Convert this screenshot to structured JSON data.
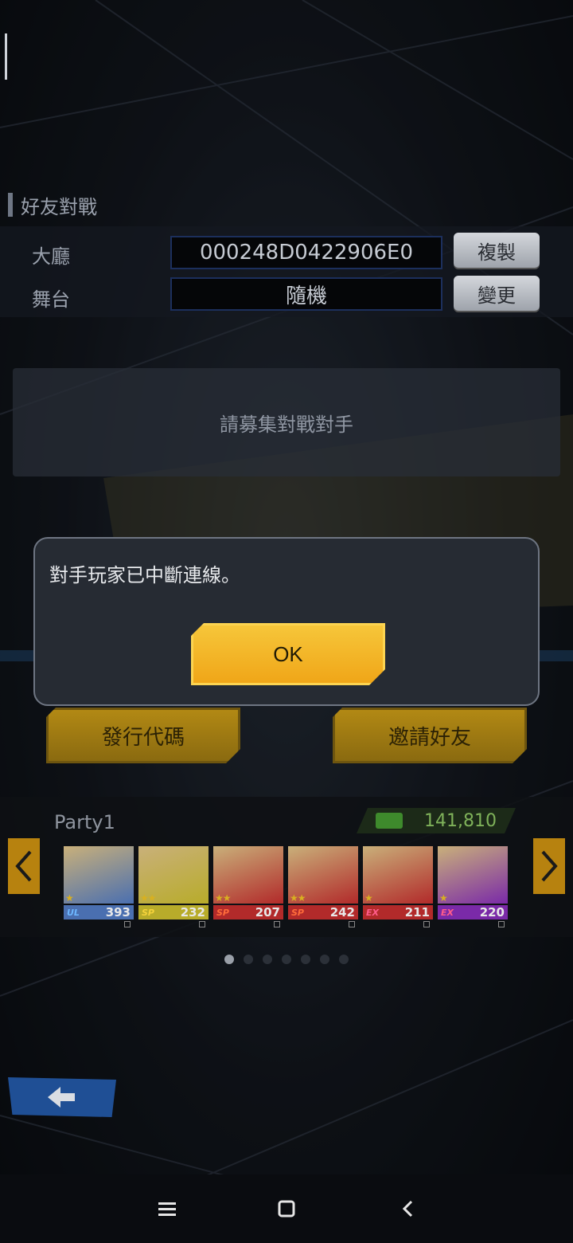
{
  "section": {
    "title": "好友對戰"
  },
  "lobby": {
    "label": "大廳",
    "value": "000248D0422906E0",
    "copy_button": "複製"
  },
  "stage": {
    "label": "舞台",
    "value": "隨機",
    "change_button": "變更"
  },
  "recruit": {
    "text": "請募集對戰對手"
  },
  "actions": {
    "issue_code": "發行代碼",
    "invite_friend": "邀請好友"
  },
  "party": {
    "name": "Party1",
    "power": "141,810",
    "characters": [
      {
        "tag": "UL",
        "level": "393",
        "stars": "★",
        "color": "#4a6fb0",
        "tag_color": "#6db7ff"
      },
      {
        "tag": "SP",
        "level": "232",
        "stars": "★★",
        "color": "#b8ac2a",
        "tag_color": "#f5d23a"
      },
      {
        "tag": "SP",
        "level": "207",
        "stars": "★★",
        "color": "#b22a2a",
        "tag_color": "#ff6b3a"
      },
      {
        "tag": "SP",
        "level": "242",
        "stars": "★★",
        "color": "#b22a2a",
        "tag_color": "#ff6b3a"
      },
      {
        "tag": "EX",
        "level": "211",
        "stars": "★",
        "color": "#b22a2a",
        "tag_color": "#ff5c8a"
      },
      {
        "tag": "EX",
        "level": "220",
        "stars": "★",
        "color": "#7a2aa8",
        "tag_color": "#ff5c8a"
      }
    ]
  },
  "dialog": {
    "message": "對手玩家已中斷連線。",
    "ok_button": "OK"
  },
  "icons": {
    "prev": "chevron-left-icon",
    "next": "chevron-right-icon",
    "back": "back-arrow-icon",
    "nav_menu": "menu-icon",
    "nav_home": "home-square-icon",
    "nav_back": "nav-back-icon"
  }
}
